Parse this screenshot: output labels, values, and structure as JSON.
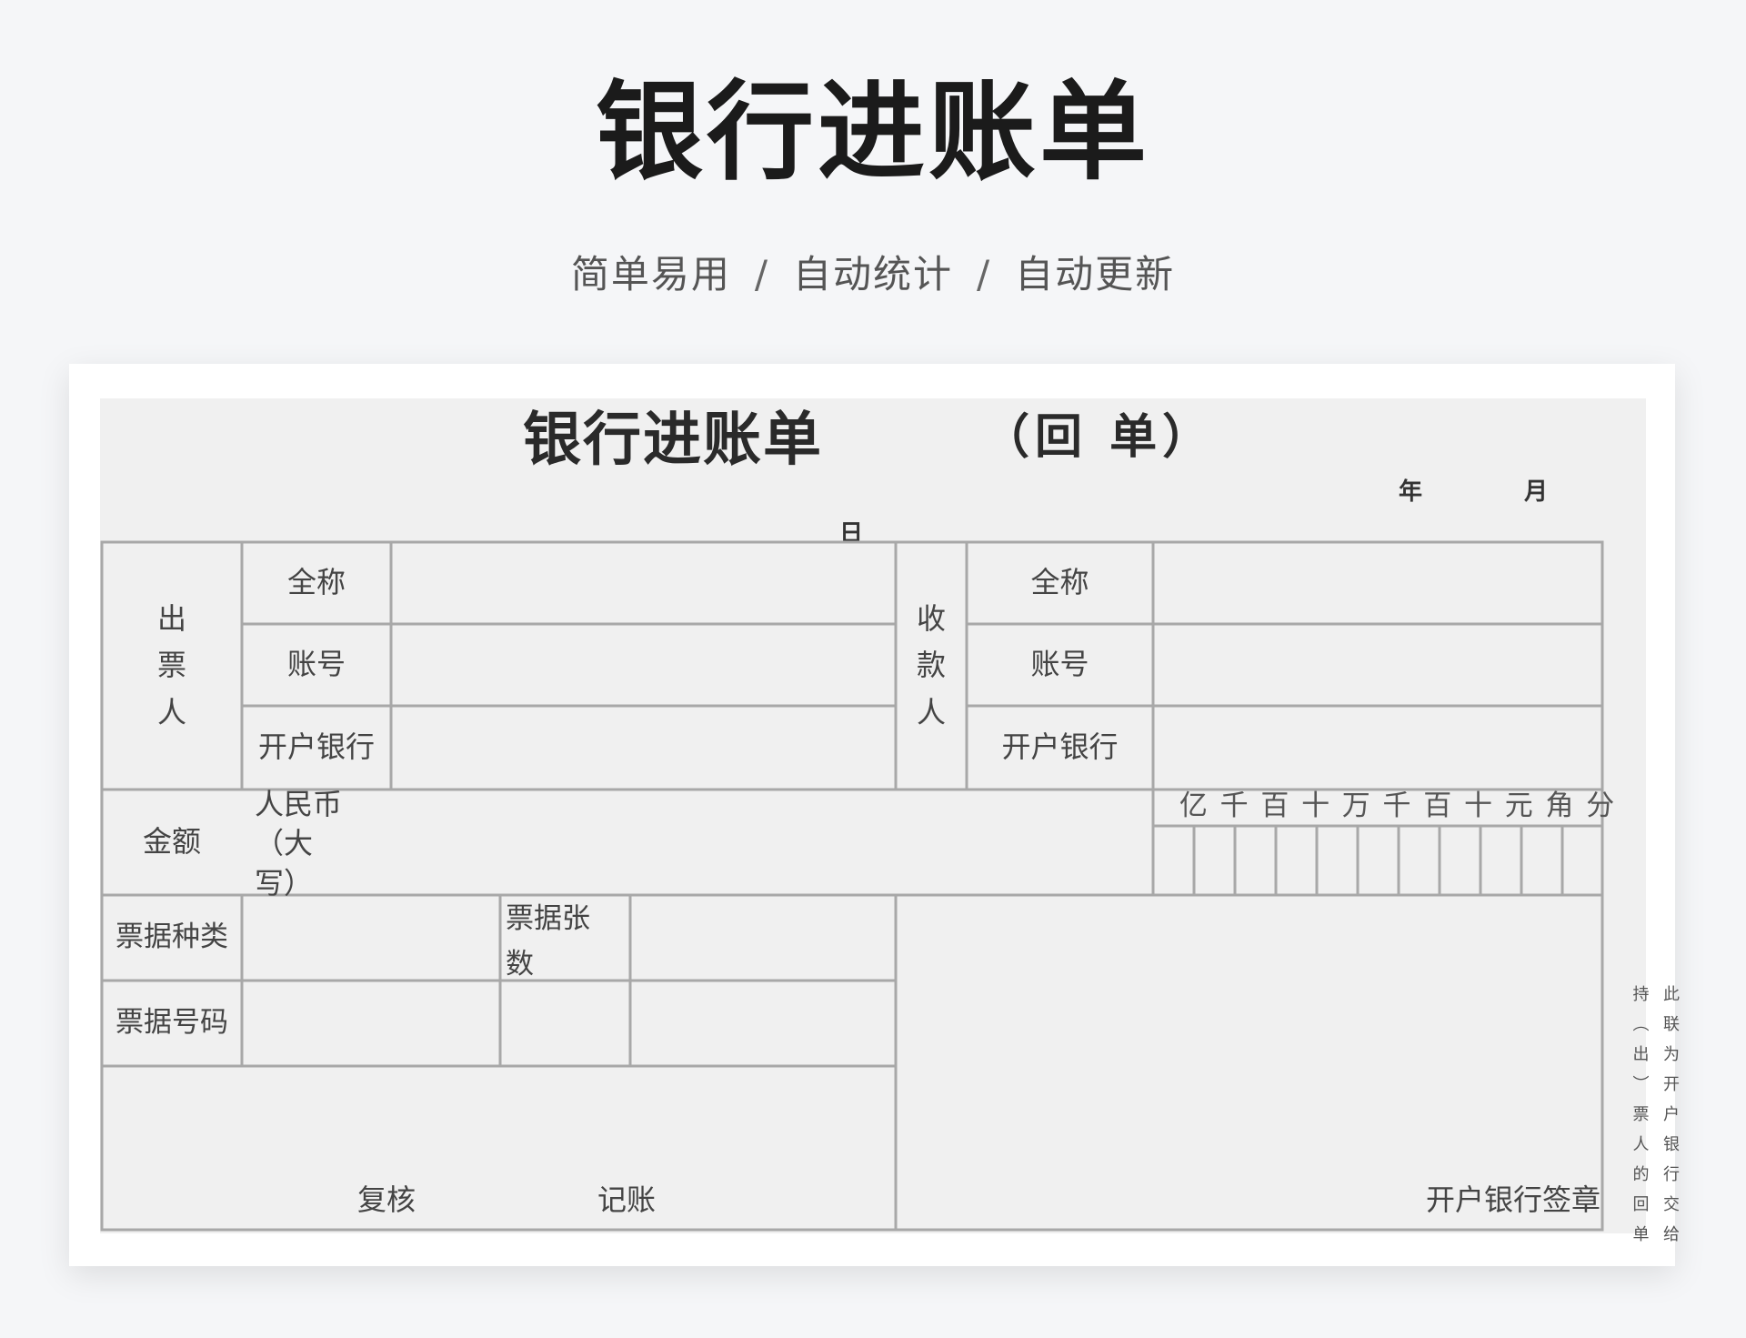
{
  "header": {
    "title": "银行进账单",
    "subtitle_items": [
      "简单易用",
      "自动统计",
      "自动更新"
    ],
    "separator": "/"
  },
  "form": {
    "title": "银行进账单",
    "copy_label": "（回 单）",
    "date": {
      "year": "年",
      "month": "月",
      "day": "日"
    },
    "payer": {
      "section_label": "出\n票\n人",
      "full_name_label": "全称",
      "account_label": "账号",
      "bank_label": "开户银行"
    },
    "payee": {
      "section_label": "收\n款\n人",
      "full_name_label": "全称",
      "account_label": "账号",
      "bank_label": "开户银行"
    },
    "amount": {
      "label": "金额",
      "currency_label": "人民币\n（大写）",
      "units": [
        "亿",
        "千",
        "百",
        "十",
        "万",
        "千",
        "百",
        "十",
        "元",
        "角",
        "分"
      ]
    },
    "bill": {
      "type_label": "票据种类",
      "count_label": "票据张\n数",
      "number_label": "票据号码"
    },
    "footer": {
      "review_label": "复核",
      "bookkeeping_label": "记账",
      "bank_seal_label": "开户银行签章"
    },
    "side_note": "此联为开户银行交给持（出）票人的回单"
  }
}
